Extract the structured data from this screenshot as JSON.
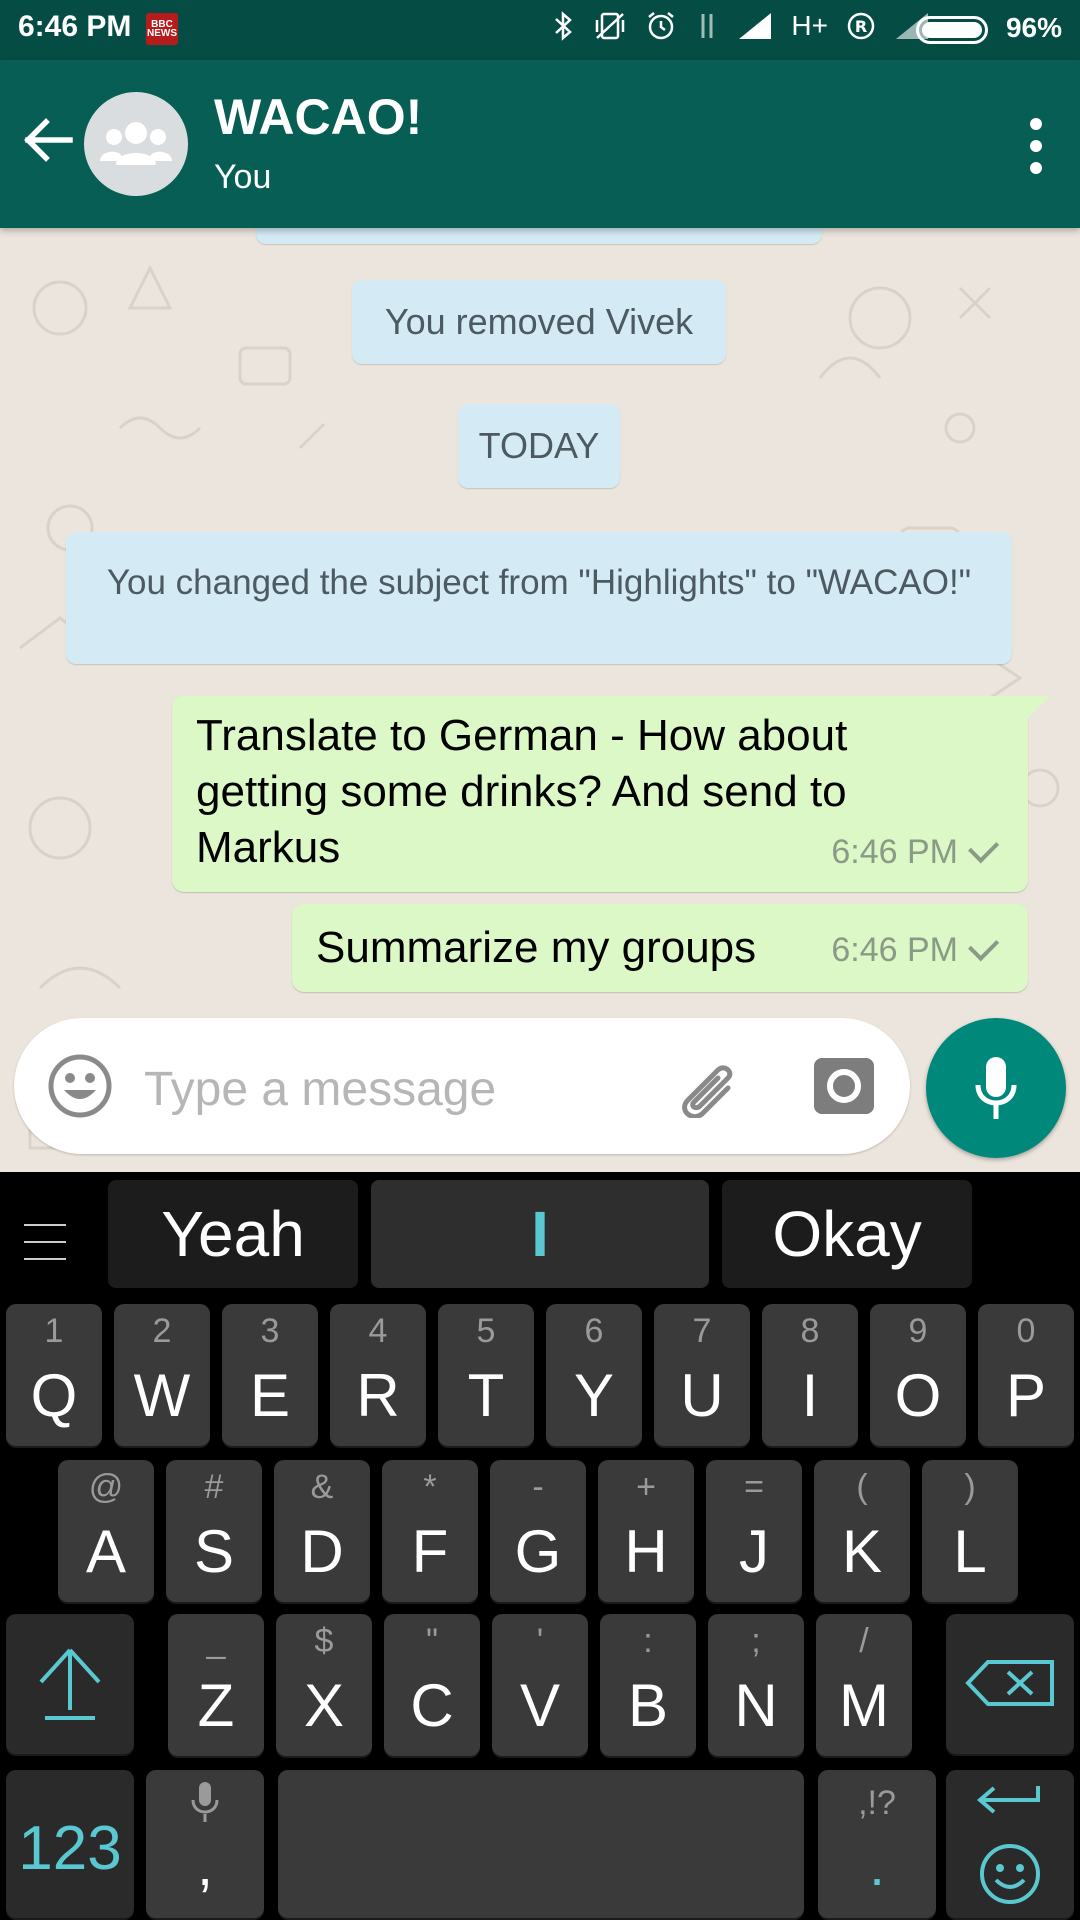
{
  "status_bar": {
    "time": "6:46 PM",
    "news_badge": "BBC NEWS",
    "network": "H+",
    "roaming": "R",
    "battery": "96%"
  },
  "header": {
    "title": "WACAO!",
    "subtitle": "You"
  },
  "messages": {
    "system_removed": "You removed Vivek",
    "date_divider": "TODAY",
    "system_subject": "You changed the subject from \"Highlights\" to \"WACAO!\"",
    "outgoing": [
      {
        "text": "Translate to German - How about getting some drinks? And send to Markus",
        "time": "6:46 PM"
      },
      {
        "text": "Summarize my groups",
        "time": "6:46 PM"
      }
    ]
  },
  "composer": {
    "placeholder": "Type a message"
  },
  "keyboard": {
    "suggestions": [
      "Yeah",
      "I",
      "Okay"
    ],
    "row1": [
      {
        "main": "Q",
        "sub": "1"
      },
      {
        "main": "W",
        "sub": "2"
      },
      {
        "main": "E",
        "sub": "3"
      },
      {
        "main": "R",
        "sub": "4"
      },
      {
        "main": "T",
        "sub": "5"
      },
      {
        "main": "Y",
        "sub": "6"
      },
      {
        "main": "U",
        "sub": "7"
      },
      {
        "main": "I",
        "sub": "8"
      },
      {
        "main": "O",
        "sub": "9"
      },
      {
        "main": "P",
        "sub": "0"
      }
    ],
    "row2": [
      {
        "main": "A",
        "sub": "@"
      },
      {
        "main": "S",
        "sub": "#"
      },
      {
        "main": "D",
        "sub": "&"
      },
      {
        "main": "F",
        "sub": "*"
      },
      {
        "main": "G",
        "sub": "-"
      },
      {
        "main": "H",
        "sub": "+"
      },
      {
        "main": "J",
        "sub": "="
      },
      {
        "main": "K",
        "sub": "("
      },
      {
        "main": "L",
        "sub": ")"
      }
    ],
    "row3": [
      {
        "main": "Z",
        "sub": "_"
      },
      {
        "main": "X",
        "sub": "$"
      },
      {
        "main": "C",
        "sub": "\""
      },
      {
        "main": "V",
        "sub": "'"
      },
      {
        "main": "B",
        "sub": ":"
      },
      {
        "main": "N",
        "sub": ";"
      },
      {
        "main": "M",
        "sub": "/"
      }
    ],
    "numbers_key": "123",
    "comma_key": ",",
    "period_key": ".",
    "period_sub": ",!?"
  },
  "colors": {
    "status_bar": "#054d44",
    "app_bar": "#075e54",
    "outgoing_bubble": "#dcf8c6",
    "system_bubble": "#d4eaf4",
    "mic_button": "#00897b",
    "keyboard_accent": "#5ac8d0"
  }
}
